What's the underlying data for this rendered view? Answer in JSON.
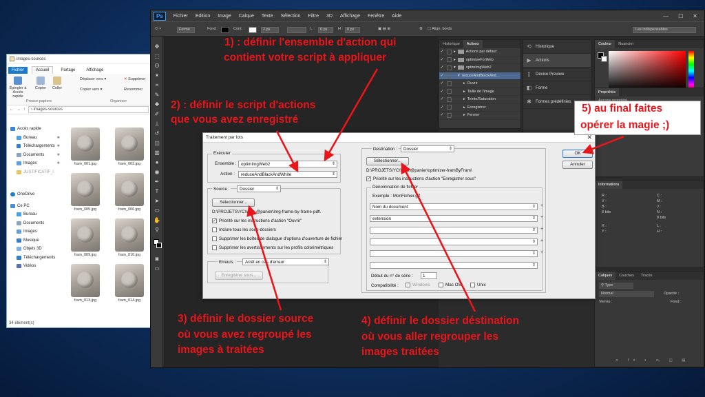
{
  "explorer": {
    "title": "images-sources",
    "tabs": [
      "Fichier",
      "Accueil",
      "Partage",
      "Affichage"
    ],
    "ribbon": {
      "pin": "Épingler à Accès rapide",
      "copy": "Copier",
      "paste": "Coller",
      "move": "Déplacer vers",
      "copy_to": "Copier vers",
      "delete": "Supprimer",
      "rename": "Renommer",
      "group_clipboard": "Presse-papiers",
      "group_organize": "Organiser"
    },
    "address": "images-sources",
    "nav": {
      "quick_access": "Accès rapide",
      "items": [
        "Bureau",
        "Téléchargements",
        "Documents",
        "Images",
        "JUSTIFICATIF_I"
      ],
      "onedrive": "OneDrive",
      "pc": "Ce PC",
      "pc_items": [
        "Bureau",
        "Documents",
        "Images",
        "Musique",
        "Objets 3D",
        "Téléchargements",
        "Vidéos"
      ]
    },
    "files": [
      "fram_001.jpg",
      "fram_002.jpg",
      "fram_005.jpg",
      "fram_006.jpg",
      "fram_009.jpg",
      "fram_010.jpg",
      "fram_013.jpg",
      "fram_014.jpg"
    ],
    "status": "34 élément(s)"
  },
  "ps": {
    "logo": "Ps",
    "menu": [
      "Fichier",
      "Edition",
      "Image",
      "Calque",
      "Texte",
      "Sélection",
      "Filtre",
      "3D",
      "Affichage",
      "Fenêtre",
      "Aide"
    ],
    "options": {
      "forme": "Forme",
      "fond": "Fond :",
      "cont": "Cont. :",
      "stroke_w": "2 px",
      "w": "L :",
      "w_val": "0 px",
      "h": "H :",
      "h_val": "0 px",
      "align": "Align. bords",
      "workspace": "Les indispensables"
    },
    "actions_panel": {
      "tabs": [
        "Historique",
        "Actions"
      ],
      "rows": [
        "Actions par défaut",
        "optimiseForWeb",
        "optimImgWeb2",
        "reduceAndBlackAnd...",
        "Ouvrir",
        "Taille de l'image",
        "Teinte/Saturation",
        "Enregistrer",
        "Fermer"
      ]
    },
    "icon_panel": [
      "Historique",
      "Actions",
      "Device Preview",
      "Forme",
      "Formes prédéfinies"
    ],
    "color_panel": {
      "tabs": [
        "Couleur",
        "Nuancier"
      ]
    },
    "props_panel": {
      "title": "Propriétés",
      "subtitle": "Aucune propriété"
    },
    "info_panel": {
      "title": "Informations",
      "r": "R :",
      "g": "V :",
      "b": "B :",
      "c": "C :",
      "m": "M :",
      "y": "J :",
      "k": "N :",
      "bits1": "8 bits",
      "bits2": "8 bits",
      "x": "X :",
      "y_coord": "Y :",
      "l": "L :",
      "h": "H :"
    },
    "layers_panel": {
      "tabs": [
        "Calques",
        "Couches",
        "Tracés"
      ],
      "kind": "Type",
      "mode": "Normal",
      "opacity": "Opacité :",
      "lock": "Verrou :",
      "fill": "Fond :"
    }
  },
  "dialog": {
    "title": "Traitement par lots",
    "execute_group": "Exécuter",
    "set_label": "Ensemble :",
    "set_value": "optimImgWeb2",
    "action_label": "Action :",
    "action_value": "reduceAndBlackAndWhite",
    "source_label": "Source :",
    "source_value": "Dossier",
    "choose_btn": "Sélectionner...",
    "source_path": "D:\\PROJETS\\YC\\Web.@panier\\img-frame-by-frame-pdt\\",
    "override_open": "Priorité sur les instructions d'action \"Ouvrir\"",
    "include_sub": "Inclure tous les sous-dossiers",
    "suppress_open": "Supprimer les boîtes de dialogue d'options d'ouverture de fichier",
    "suppress_profile": "Supprimer les avertissements sur les profils colorimétriques",
    "errors_label": "Erreurs :",
    "errors_value": "Arrêt en cas d'erreur",
    "save_as_btn": "Enregistrer sous...",
    "dest_label": "Destination :",
    "dest_value": "Dossier",
    "dest_choose_btn": "Sélectionner...",
    "dest_path": "D:\\PROJETS\\YC\\Web.@panier\\optimizer-framByFram\\",
    "override_save": "Priorité sur les instructions d'action \"Enregistrer sous\"",
    "naming_group": "Dénomination de fichier",
    "example": "Exemple : MonFichier.gif",
    "name_fields": [
      "Nom du document",
      "extension",
      "",
      "",
      "",
      ""
    ],
    "serial_label": "Début du n° de série :",
    "serial_value": "1",
    "compat_label": "Compatibilité :",
    "compat_windows": "Windows",
    "compat_macos": "Mac OS",
    "compat_unix": "Unix",
    "ok": "OK",
    "cancel": "Annuler"
  },
  "annotations": {
    "a1_l1": "1) : définir l'ensemble d'action qui",
    "a1_l2": "contient votre script à appliquer",
    "a2_l1": "2) : définir le script d'actions",
    "a2_l2": "que vous avez enregistré",
    "a3_l1": "3) définir le dossier source",
    "a3_l2": "où vous avez regroupé les",
    "a3_l3": "images à traitées",
    "a4_l1": "4) définir le dossier déstination",
    "a4_l2": "où vous aller regrouper les",
    "a4_l3": "images traitées",
    "a5_l1": "5) au final faites",
    "a5_l2": "opérer la magie ;)",
    "color": "#e8151b"
  }
}
